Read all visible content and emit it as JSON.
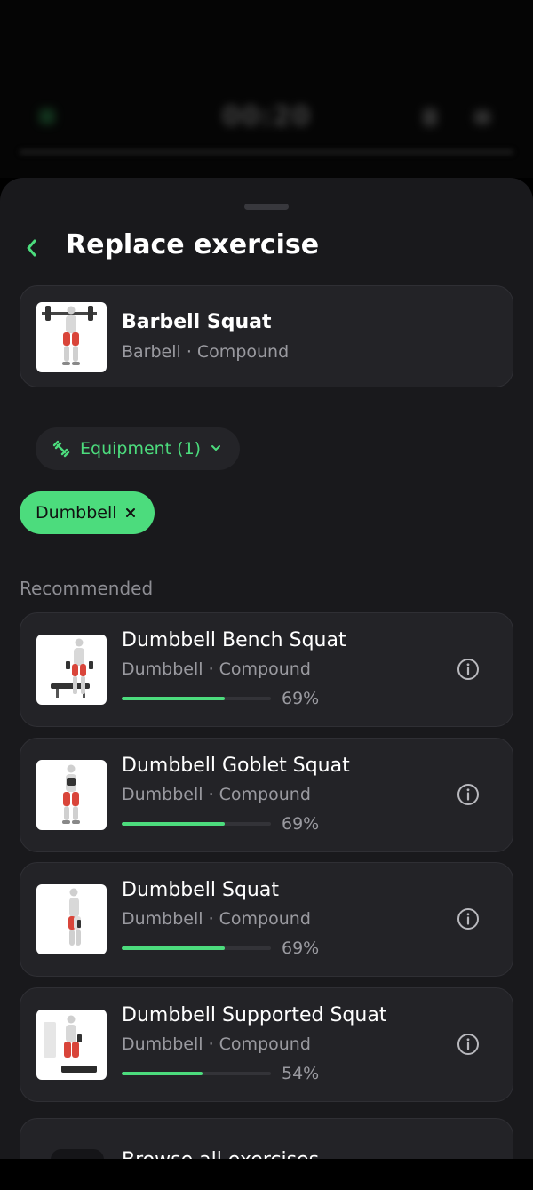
{
  "background": {
    "timer": "00:20"
  },
  "sheet": {
    "title": "Replace exercise",
    "current_exercise": {
      "name": "Barbell Squat",
      "meta": "Barbell · Compound"
    },
    "filter": {
      "label": "Equipment (1)",
      "chip": "Dumbbell"
    },
    "section_label": "Recommended",
    "recommended": [
      {
        "name": "Dumbbell Bench Squat",
        "meta": "Dumbbell · Compound",
        "match": 0.69,
        "match_label": "69%"
      },
      {
        "name": "Dumbbell Goblet Squat",
        "meta": "Dumbbell · Compound",
        "match": 0.69,
        "match_label": "69%"
      },
      {
        "name": "Dumbbell Squat",
        "meta": "Dumbbell · Compound",
        "match": 0.69,
        "match_label": "69%"
      },
      {
        "name": "Dumbbell Supported Squat",
        "meta": "Dumbbell · Compound",
        "match": 0.54,
        "match_label": "54%"
      }
    ],
    "browse_label": "Browse all exercises"
  },
  "colors": {
    "accent": "#4cdc7d",
    "sheet_bg": "#19191c",
    "card_bg": "#232327",
    "muted_text": "#9a9aa0",
    "muscle_highlight": "#d9453a"
  },
  "icons": {
    "back": "chevron-left-icon",
    "equipment": "dumbbell-icon",
    "dropdown": "chevron-down-icon",
    "remove": "close-icon",
    "info": "info-circle-icon"
  }
}
